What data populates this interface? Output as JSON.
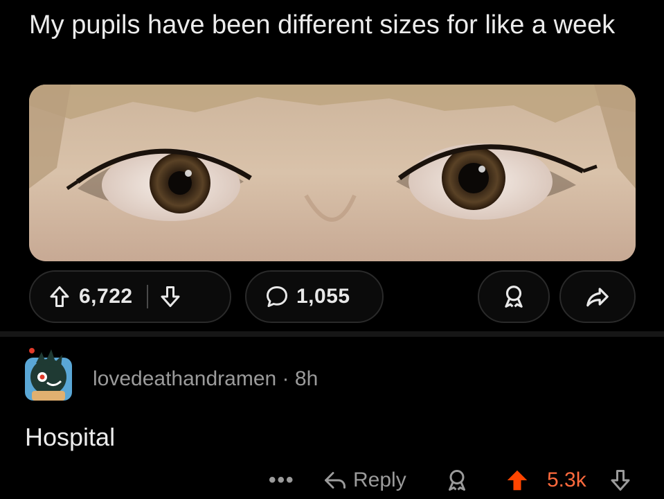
{
  "post": {
    "title": "My pupils have been different sizes for like a week",
    "image_description": "",
    "upvotes": "6,722",
    "comments": "1,055"
  },
  "comment": {
    "username": "lovedeathandramen",
    "separator": "·",
    "age": "8h",
    "body": "Hospital",
    "more": "•••",
    "reply_label": "Reply",
    "score": "5.3k"
  },
  "colors": {
    "background": "#000000",
    "upvote_active": "#ff4500",
    "score": "#ff6a3d",
    "muted_text": "#9b9b9b"
  },
  "icons": {
    "upvote": "arrow-up-outline-icon",
    "downvote": "arrow-down-outline-icon",
    "comment": "speech-bubble-icon",
    "award": "award-ribbon-icon",
    "share": "share-arrow-icon",
    "reply": "reply-arrow-icon",
    "upvoted": "arrow-up-filled-icon"
  }
}
